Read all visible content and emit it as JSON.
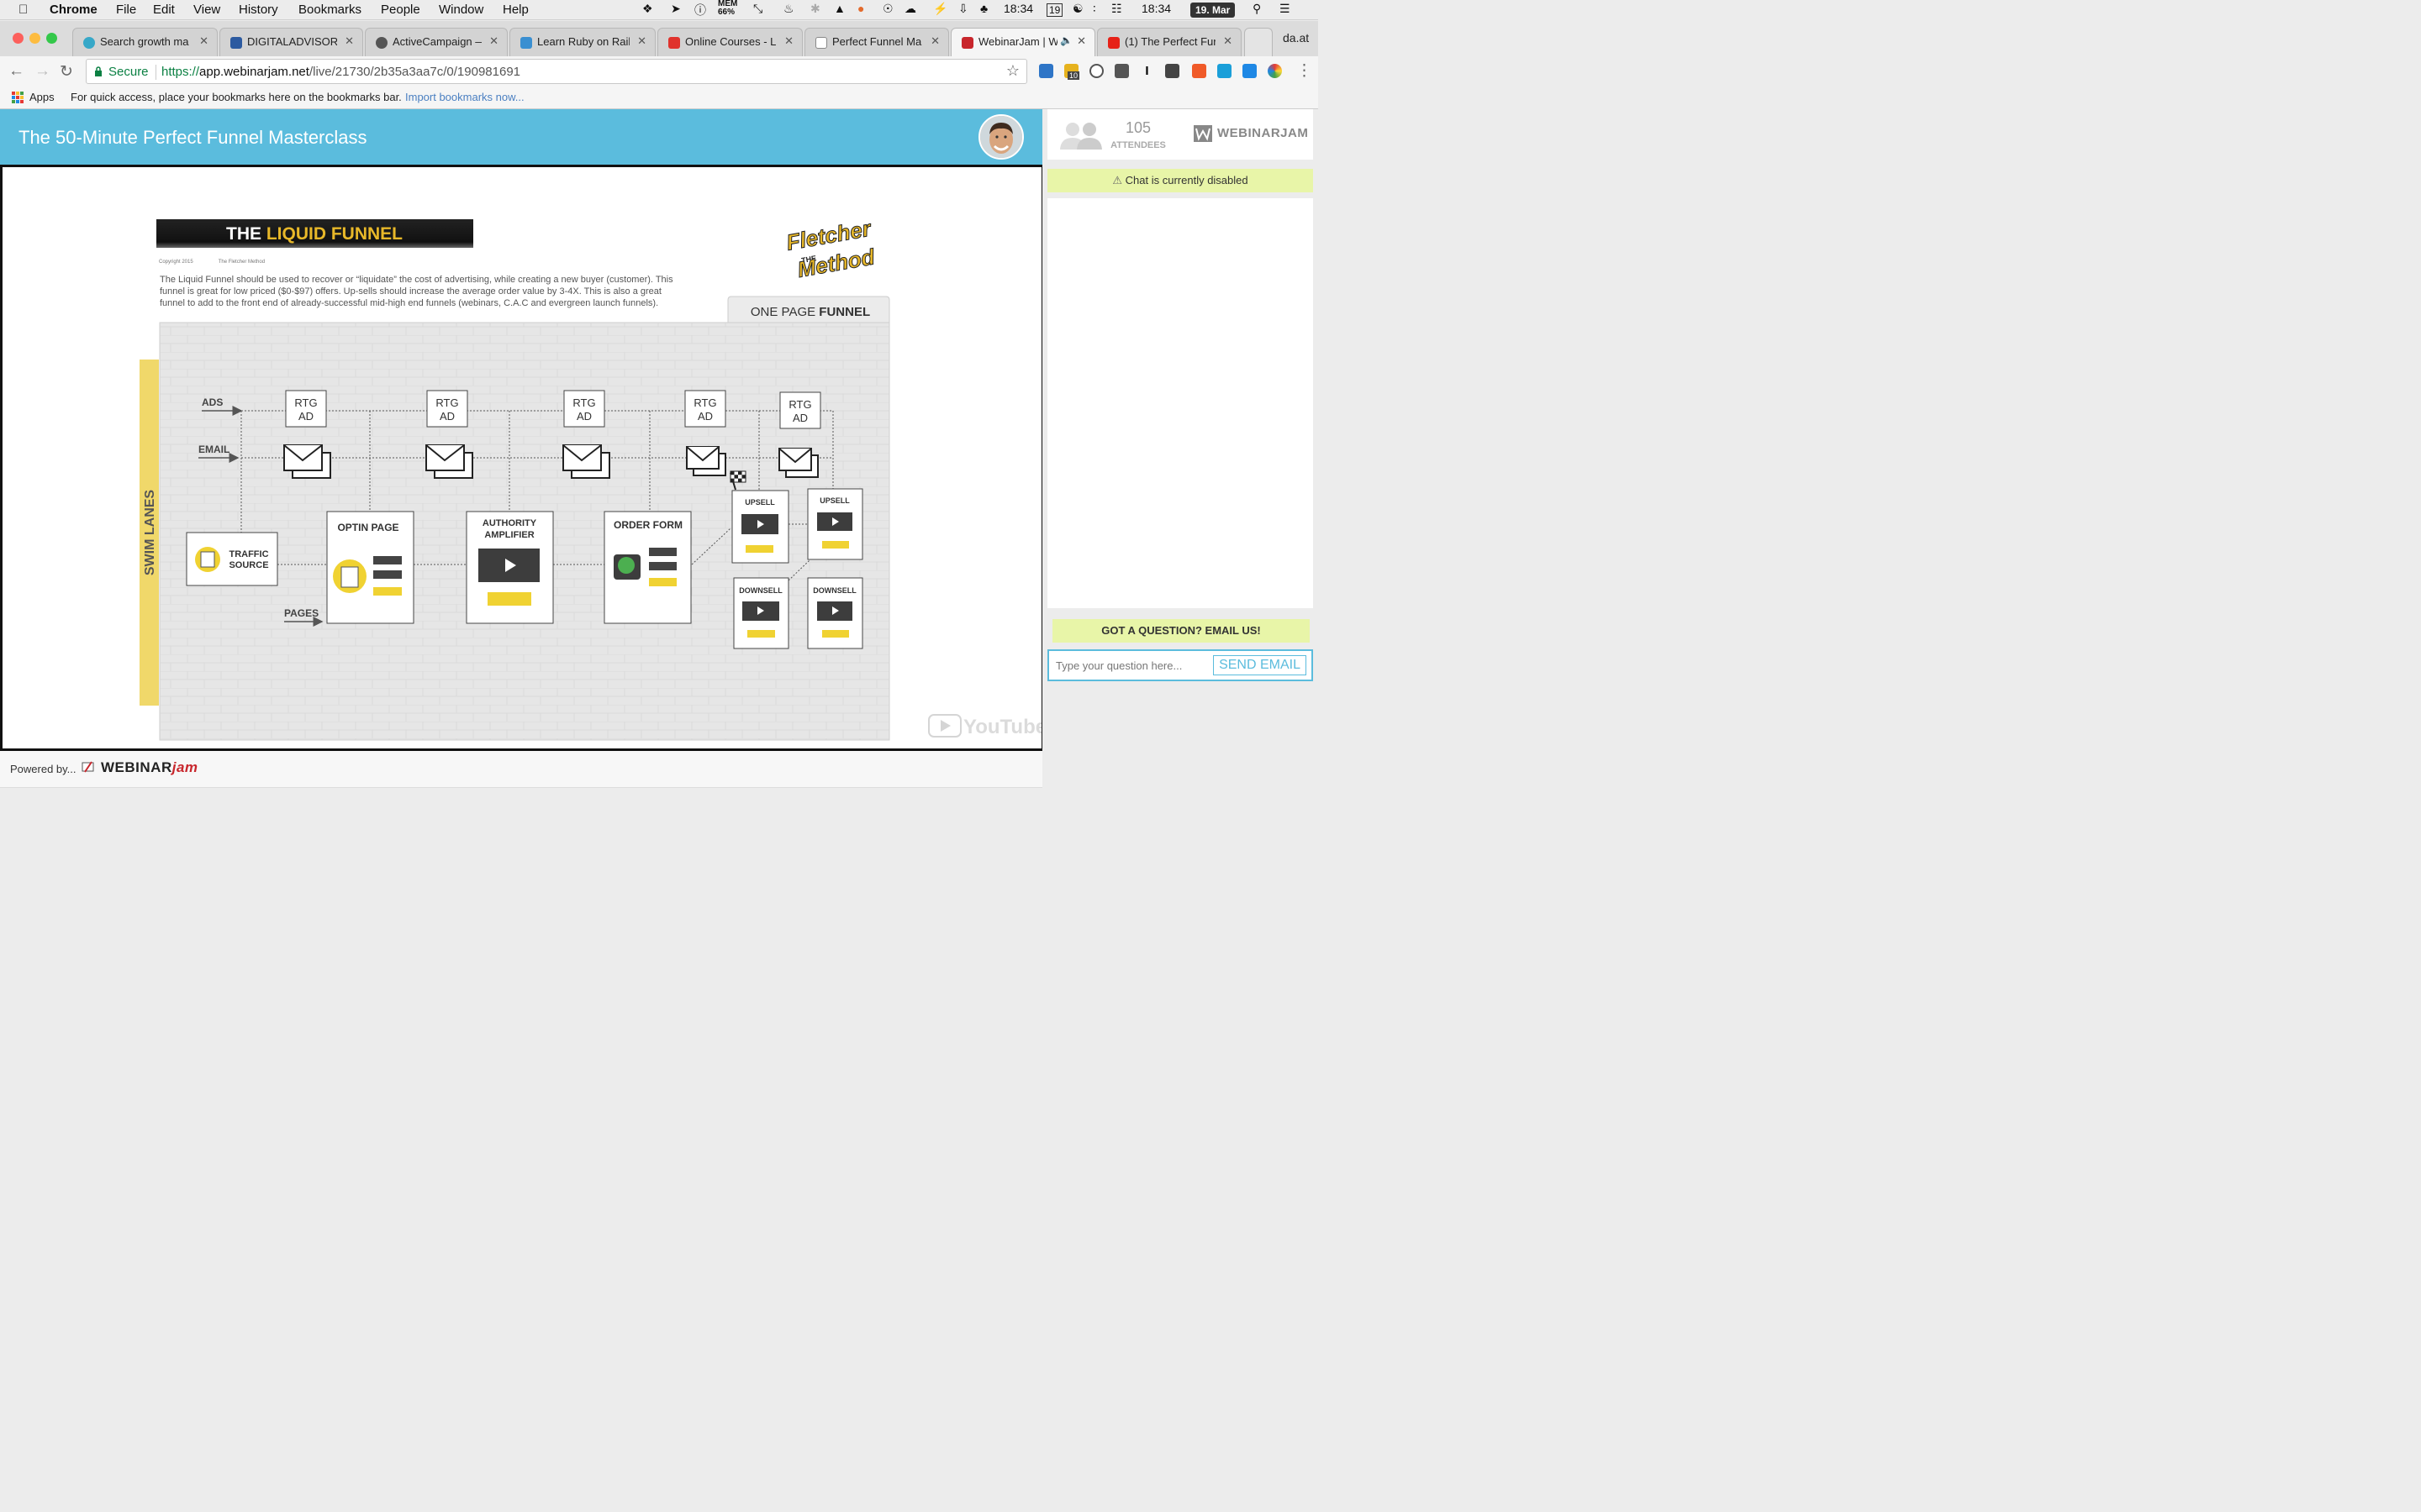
{
  "menubar": {
    "app": "Chrome",
    "items": [
      "File",
      "Edit",
      "View",
      "History",
      "Bookmarks",
      "People",
      "Window",
      "Help"
    ],
    "mem_label": "MEM",
    "mem_value": "66%",
    "calendar_day": "19",
    "time_1": "18:34",
    "time_2": "18:34",
    "date": "19. Mar"
  },
  "tabs": [
    {
      "label": "Search growth ma",
      "favicon": "circle-icon"
    },
    {
      "label": "DIGITALADVISORY",
      "favicon": "d-icon"
    },
    {
      "label": "ActiveCampaign —",
      "favicon": "wordpress-icon"
    },
    {
      "label": "Learn Ruby on Rail",
      "favicon": "rails-icon"
    },
    {
      "label": "Online Courses - L",
      "favicon": "udemy-icon"
    },
    {
      "label": "Perfect Funnel Ma",
      "favicon": "document-icon"
    },
    {
      "label": "WebinarJam | W",
      "favicon": "webinarjam-icon",
      "active": true
    },
    {
      "label": "(1) The Perfect Fur",
      "favicon": "youtube-icon"
    }
  ],
  "profile_name": "da.at",
  "toolbar": {
    "secure_label": "Secure",
    "url_scheme": "https://",
    "url_host": "app.webinarjam.net",
    "url_path": "/live/21730/2b35a3aa7c/0/190981691",
    "ext_badge": "10"
  },
  "bookmarks": {
    "apps_label": "Apps",
    "hint": "For quick access, place your bookmarks here on the bookmarks bar.",
    "import_link": "Import bookmarks now..."
  },
  "webinar": {
    "title": "The 50-Minute Perfect Funnel Masterclass",
    "powered_by": "Powered by...",
    "powered_logo": "WEBINAR",
    "powered_logo_jam": "jam"
  },
  "slide": {
    "banner_the": "THE ",
    "banner_title": "LIQUID FUNNEL",
    "copyright": "Copyright 2015",
    "copyright_owner": "The Fletcher Method",
    "brand_line1": "Fletcher",
    "brand_the": "THE",
    "brand_line2": "Method",
    "description_1": "The Liquid Funnel should be used to recover or “liquidate” the cost of advertising, while creating a new buyer (customer). This",
    "description_2": "funnel is great for low priced ($0-$97) offers. Up-sells should increase the average order value by 3-4X. This is also a great",
    "description_3": "funnel to add to the front end of already-successful mid-high end funnels (webinars, C.A.C and evergreen launch funnels).",
    "funnel_type_light": "ONE PAGE ",
    "funnel_type_bold": "FUNNEL",
    "swim_lanes": "SWIM LANES",
    "lane_ads": "ADS",
    "lane_email": "EMAIL",
    "lane_pages": "PAGES",
    "rtg_line1": "RTG",
    "rtg_line2": "AD",
    "traffic_1": "TRAFFIC",
    "traffic_2": "SOURCE",
    "optin": "OPTIN PAGE",
    "authority_1": "AUTHORITY",
    "authority_2": "AMPLIFIER",
    "order_form": "ORDER FORM",
    "upsell": "UPSELL",
    "downsell": "DOWNSELL",
    "watermark": "YouTube"
  },
  "sidebar": {
    "attendees_count": "105",
    "attendees_label": "ATTENDEES",
    "logo": "WEBINARJAM",
    "chat_disabled": "Chat is currently disabled",
    "question_header": "GOT A QUESTION? EMAIL US!",
    "question_placeholder": "Type your question here...",
    "send_button": "SEND EMAIL"
  },
  "colors": {
    "header_blue": "#5bbcdd",
    "banner_yellow": "#e8b829",
    "chat_notice_bg": "#e8f5a8",
    "accent_yellow": "#f0d232"
  }
}
